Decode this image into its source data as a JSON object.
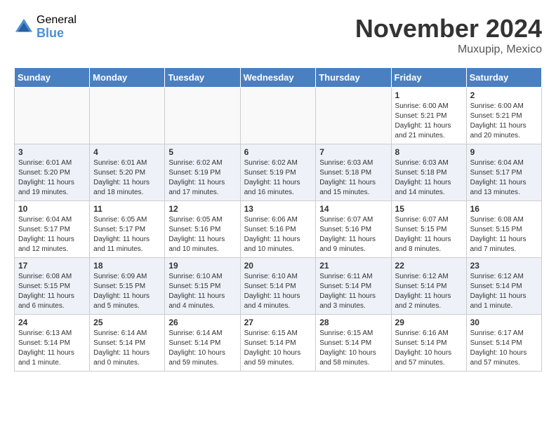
{
  "header": {
    "logo_general": "General",
    "logo_blue": "Blue",
    "month_title": "November 2024",
    "location": "Muxupip, Mexico"
  },
  "weekdays": [
    "Sunday",
    "Monday",
    "Tuesday",
    "Wednesday",
    "Thursday",
    "Friday",
    "Saturday"
  ],
  "weeks": [
    [
      {
        "day": "",
        "info": ""
      },
      {
        "day": "",
        "info": ""
      },
      {
        "day": "",
        "info": ""
      },
      {
        "day": "",
        "info": ""
      },
      {
        "day": "",
        "info": ""
      },
      {
        "day": "1",
        "info": "Sunrise: 6:00 AM\nSunset: 5:21 PM\nDaylight: 11 hours\nand 21 minutes."
      },
      {
        "day": "2",
        "info": "Sunrise: 6:00 AM\nSunset: 5:21 PM\nDaylight: 11 hours\nand 20 minutes."
      }
    ],
    [
      {
        "day": "3",
        "info": "Sunrise: 6:01 AM\nSunset: 5:20 PM\nDaylight: 11 hours\nand 19 minutes."
      },
      {
        "day": "4",
        "info": "Sunrise: 6:01 AM\nSunset: 5:20 PM\nDaylight: 11 hours\nand 18 minutes."
      },
      {
        "day": "5",
        "info": "Sunrise: 6:02 AM\nSunset: 5:19 PM\nDaylight: 11 hours\nand 17 minutes."
      },
      {
        "day": "6",
        "info": "Sunrise: 6:02 AM\nSunset: 5:19 PM\nDaylight: 11 hours\nand 16 minutes."
      },
      {
        "day": "7",
        "info": "Sunrise: 6:03 AM\nSunset: 5:18 PM\nDaylight: 11 hours\nand 15 minutes."
      },
      {
        "day": "8",
        "info": "Sunrise: 6:03 AM\nSunset: 5:18 PM\nDaylight: 11 hours\nand 14 minutes."
      },
      {
        "day": "9",
        "info": "Sunrise: 6:04 AM\nSunset: 5:17 PM\nDaylight: 11 hours\nand 13 minutes."
      }
    ],
    [
      {
        "day": "10",
        "info": "Sunrise: 6:04 AM\nSunset: 5:17 PM\nDaylight: 11 hours\nand 12 minutes."
      },
      {
        "day": "11",
        "info": "Sunrise: 6:05 AM\nSunset: 5:17 PM\nDaylight: 11 hours\nand 11 minutes."
      },
      {
        "day": "12",
        "info": "Sunrise: 6:05 AM\nSunset: 5:16 PM\nDaylight: 11 hours\nand 10 minutes."
      },
      {
        "day": "13",
        "info": "Sunrise: 6:06 AM\nSunset: 5:16 PM\nDaylight: 11 hours\nand 10 minutes."
      },
      {
        "day": "14",
        "info": "Sunrise: 6:07 AM\nSunset: 5:16 PM\nDaylight: 11 hours\nand 9 minutes."
      },
      {
        "day": "15",
        "info": "Sunrise: 6:07 AM\nSunset: 5:15 PM\nDaylight: 11 hours\nand 8 minutes."
      },
      {
        "day": "16",
        "info": "Sunrise: 6:08 AM\nSunset: 5:15 PM\nDaylight: 11 hours\nand 7 minutes."
      }
    ],
    [
      {
        "day": "17",
        "info": "Sunrise: 6:08 AM\nSunset: 5:15 PM\nDaylight: 11 hours\nand 6 minutes."
      },
      {
        "day": "18",
        "info": "Sunrise: 6:09 AM\nSunset: 5:15 PM\nDaylight: 11 hours\nand 5 minutes."
      },
      {
        "day": "19",
        "info": "Sunrise: 6:10 AM\nSunset: 5:15 PM\nDaylight: 11 hours\nand 4 minutes."
      },
      {
        "day": "20",
        "info": "Sunrise: 6:10 AM\nSunset: 5:14 PM\nDaylight: 11 hours\nand 4 minutes."
      },
      {
        "day": "21",
        "info": "Sunrise: 6:11 AM\nSunset: 5:14 PM\nDaylight: 11 hours\nand 3 minutes."
      },
      {
        "day": "22",
        "info": "Sunrise: 6:12 AM\nSunset: 5:14 PM\nDaylight: 11 hours\nand 2 minutes."
      },
      {
        "day": "23",
        "info": "Sunrise: 6:12 AM\nSunset: 5:14 PM\nDaylight: 11 hours\nand 1 minute."
      }
    ],
    [
      {
        "day": "24",
        "info": "Sunrise: 6:13 AM\nSunset: 5:14 PM\nDaylight: 11 hours\nand 1 minute."
      },
      {
        "day": "25",
        "info": "Sunrise: 6:14 AM\nSunset: 5:14 PM\nDaylight: 11 hours\nand 0 minutes."
      },
      {
        "day": "26",
        "info": "Sunrise: 6:14 AM\nSunset: 5:14 PM\nDaylight: 10 hours\nand 59 minutes."
      },
      {
        "day": "27",
        "info": "Sunrise: 6:15 AM\nSunset: 5:14 PM\nDaylight: 10 hours\nand 59 minutes."
      },
      {
        "day": "28",
        "info": "Sunrise: 6:15 AM\nSunset: 5:14 PM\nDaylight: 10 hours\nand 58 minutes."
      },
      {
        "day": "29",
        "info": "Sunrise: 6:16 AM\nSunset: 5:14 PM\nDaylight: 10 hours\nand 57 minutes."
      },
      {
        "day": "30",
        "info": "Sunrise: 6:17 AM\nSunset: 5:14 PM\nDaylight: 10 hours\nand 57 minutes."
      }
    ]
  ]
}
